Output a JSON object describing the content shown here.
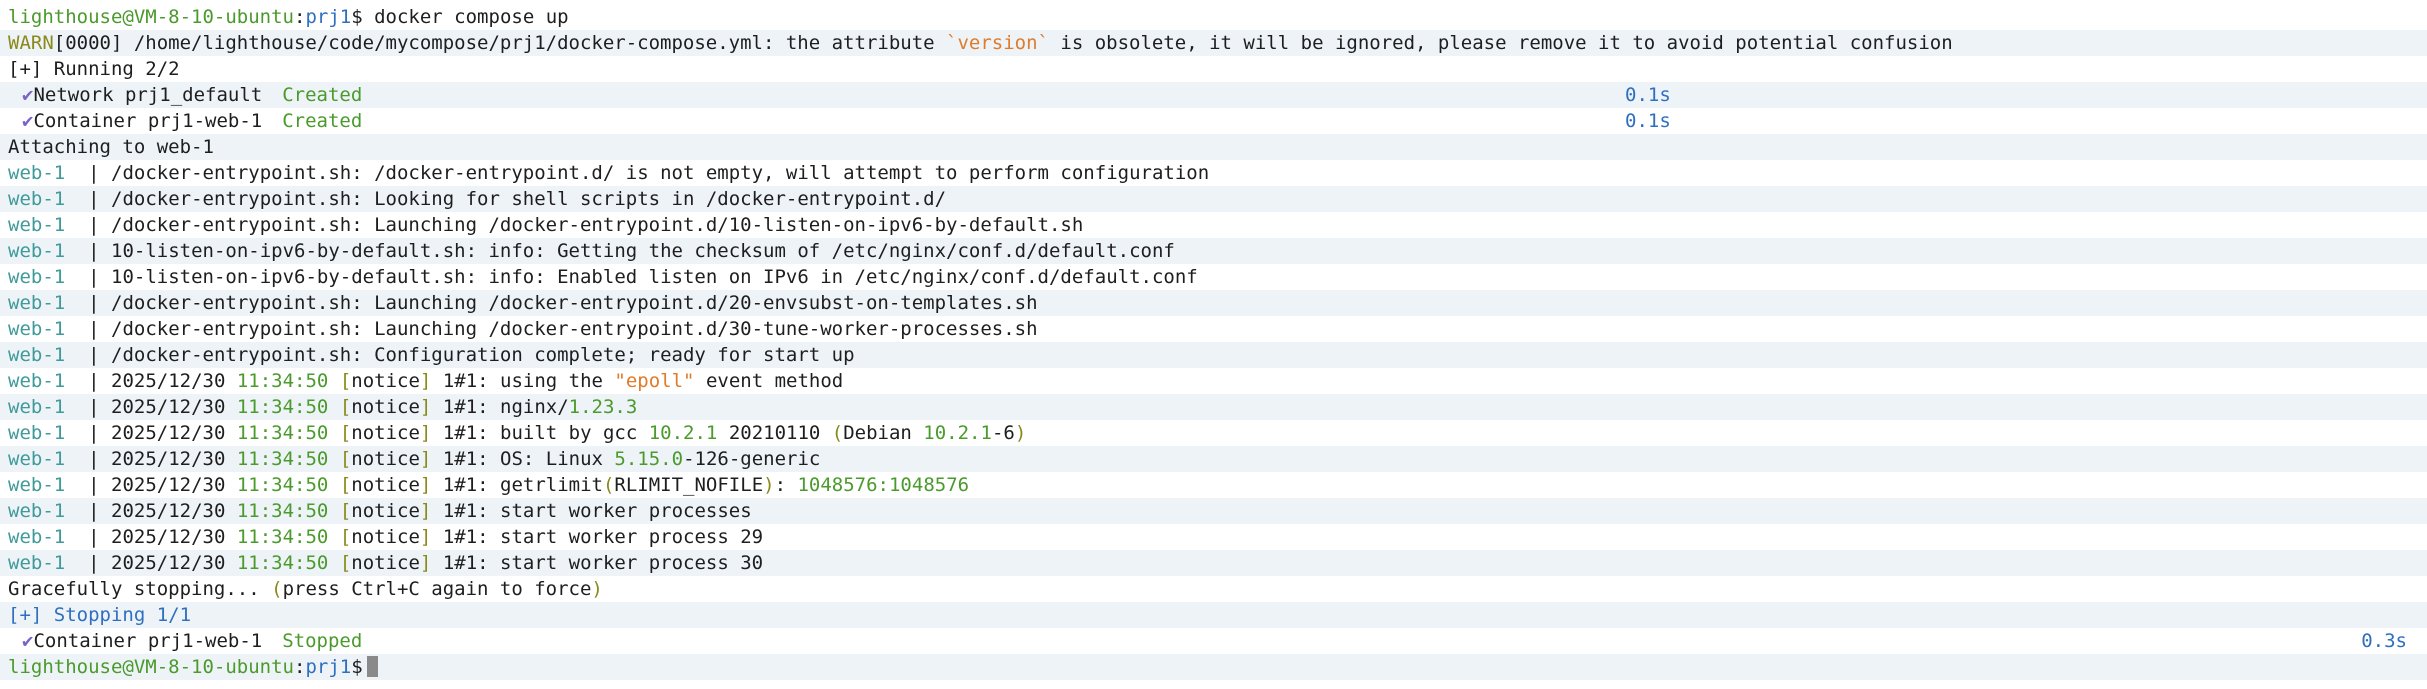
{
  "prompt": {
    "user_host": "lighthouse@VM-8-10-ubuntu",
    "sep": ":",
    "path": "prj1",
    "sigil": "$"
  },
  "command": "docker compose up",
  "warn": {
    "tag": "WARN",
    "code": "[0000]",
    "text_before": " /home/lighthouse/code/mycompose/prj1/docker-compose.yml: the attribute ",
    "attr": "`version`",
    "text_after": " is obsolete, it will be ignored, please remove it to avoid potential confusion"
  },
  "running": {
    "label": "[+] Running 2/2",
    "items": [
      {
        "check": "✔",
        "name": "Network prj1_default",
        "status": "Created",
        "time": "0.1s"
      },
      {
        "check": "✔",
        "name": "Container prj1-web-1",
        "status": "Created",
        "time": "0.1s"
      }
    ]
  },
  "attaching": "Attaching to web-1",
  "log_prefix": "web-1",
  "log_pipe": "|",
  "plain_logs": [
    "/docker-entrypoint.sh: /docker-entrypoint.d/ is not empty, will attempt to perform configuration",
    "/docker-entrypoint.sh: Looking for shell scripts in /docker-entrypoint.d/",
    "/docker-entrypoint.sh: Launching /docker-entrypoint.d/10-listen-on-ipv6-by-default.sh",
    "10-listen-on-ipv6-by-default.sh: info: Getting the checksum of /etc/nginx/conf.d/default.conf",
    "10-listen-on-ipv6-by-default.sh: info: Enabled listen on IPv6 in /etc/nginx/conf.d/default.conf",
    "/docker-entrypoint.sh: Launching /docker-entrypoint.d/20-envsubst-on-templates.sh",
    "/docker-entrypoint.sh: Launching /docker-entrypoint.d/30-tune-worker-processes.sh",
    "/docker-entrypoint.sh: Configuration complete; ready for start up"
  ],
  "notice": {
    "date": "2025/12/30",
    "time": "11:34:50",
    "bracket_open": "[",
    "level": "notice",
    "bracket_close": "]",
    "pid": "1#1:"
  },
  "notice_lines": {
    "l1": {
      "a": " using the ",
      "b": "\"epoll\"",
      "c": " event method"
    },
    "l2": {
      "a": " nginx/",
      "b": "1.23.3"
    },
    "l3": {
      "a": " built by gcc ",
      "b": "10.2.1",
      "c": " 20210110 ",
      "d": "(",
      "e": "Debian ",
      "f": "10.2.1",
      "g": "-6",
      "h": ")"
    },
    "l4": {
      "a": " OS: Linux ",
      "b": "5.15.0",
      "c": "-126-generic"
    },
    "l5": {
      "a": " getrlimit",
      "b": "(",
      "c": "RLIMIT_NOFILE",
      "d": ")",
      "e": ": ",
      "f": "1048576:1048576"
    },
    "l6": {
      "a": " start worker processes"
    },
    "l7": {
      "a": " start worker process 29"
    },
    "l8": {
      "a": " start worker process 30"
    }
  },
  "graceful": {
    "a": "Gracefully stopping... ",
    "b": "(",
    "c": "press Ctrl+C again to force",
    "d": ")"
  },
  "stopping": {
    "label": "[+] Stopping 1/1",
    "items": [
      {
        "check": "✔",
        "name": "Container prj1-web-1",
        "status": "Stopped",
        "time": "0.3s"
      }
    ]
  },
  "colors": {
    "prompt_green": "#4a9a2c",
    "path_blue": "#2f6fbf",
    "warn_orange": "#e07b2a",
    "check_purple": "#7a63c9",
    "row_stripe": "#eef3f8"
  }
}
